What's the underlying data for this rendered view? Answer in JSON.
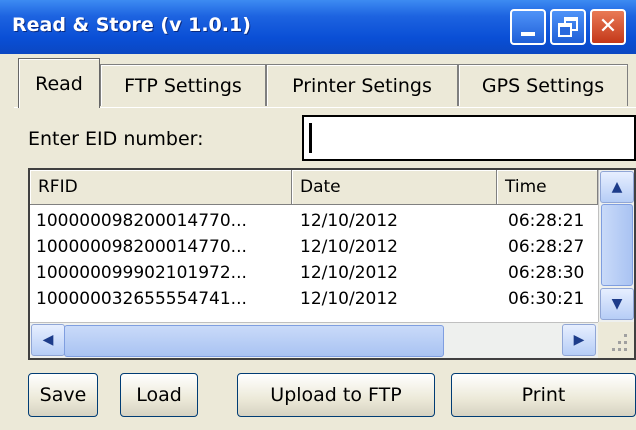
{
  "window": {
    "title": "Read & Store (v 1.0.1)"
  },
  "tabs": [
    {
      "label": "Read",
      "active": true
    },
    {
      "label": "FTP Settings",
      "active": false
    },
    {
      "label": "Printer Setings",
      "active": false
    },
    {
      "label": "GPS Settings",
      "active": false
    }
  ],
  "eid": {
    "label": "Enter EID number:",
    "value": ""
  },
  "table": {
    "columns": [
      "RFID",
      "Date",
      "Time"
    ],
    "rows": [
      {
        "rfid": "100000098200014770...",
        "date": "12/10/2012",
        "time": "06:28:21"
      },
      {
        "rfid": "100000098200014770...",
        "date": "12/10/2012",
        "time": "06:28:27"
      },
      {
        "rfid": "100000099902101972...",
        "date": "12/10/2012",
        "time": "06:28:30"
      },
      {
        "rfid": "100000032655554741...",
        "date": "12/10/2012",
        "time": "06:30:21"
      }
    ]
  },
  "buttons": {
    "save": "Save",
    "load": "Load",
    "upload": "Upload to FTP",
    "print": "Print"
  },
  "colors": {
    "title_bar": "#0a4fd6",
    "close_button": "#c4381a",
    "face": "#ece9d8"
  }
}
